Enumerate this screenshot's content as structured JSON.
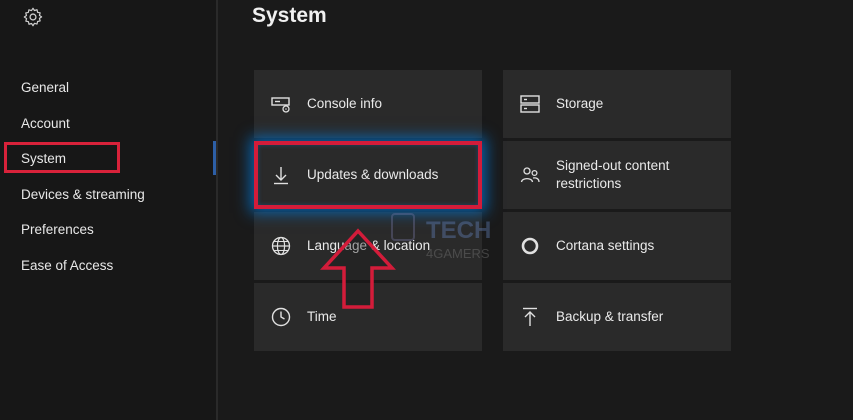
{
  "page": {
    "title": "System"
  },
  "sidebar": {
    "settings_icon": "gear-icon",
    "items": [
      {
        "label": "General"
      },
      {
        "label": "Account"
      },
      {
        "label": "System"
      },
      {
        "label": "Devices & streaming"
      },
      {
        "label": "Preferences"
      },
      {
        "label": "Ease of Access"
      }
    ],
    "selected_index": 2
  },
  "tiles": [
    {
      "label": "Console info",
      "icon": "console-icon"
    },
    {
      "label": "Storage",
      "icon": "storage-icon"
    },
    {
      "label": "Updates & downloads",
      "icon": "download-icon",
      "highlighted": true
    },
    {
      "label": "Signed-out content restrictions",
      "icon": "people-icon"
    },
    {
      "label": "Language & location",
      "icon": "globe-icon"
    },
    {
      "label": "Cortana settings",
      "icon": "cortana-icon"
    },
    {
      "label": "Time",
      "icon": "clock-icon"
    },
    {
      "label": "Backup & transfer",
      "icon": "upload-icon"
    }
  ],
  "watermark": {
    "line1": "TECH",
    "line2": "4GAMERS"
  },
  "colors": {
    "background": "#1a1a1a",
    "tile": "#2a2a2a",
    "highlight_border": "#d31c3a",
    "highlight_glow": "#0078d7",
    "nav_indicator": "#2d5fa6"
  }
}
